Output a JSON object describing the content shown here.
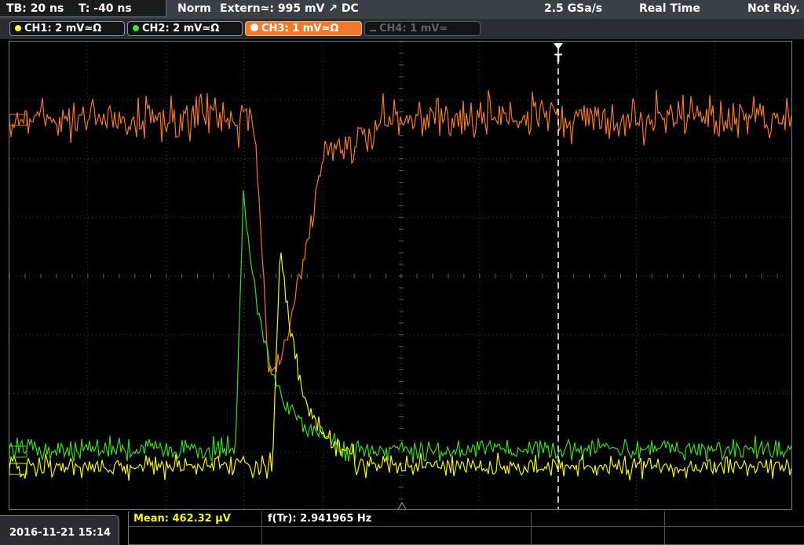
{
  "topbar": {
    "timebase": "TB: 20 ns",
    "trigger_time": "T: -40 ns",
    "mode": "Norm",
    "trigger": "Extern≃: 995 mV ↗ DC",
    "sample_rate": "2.5 GSa/s",
    "acquisition": "Real Time",
    "status": "Not Rdy."
  },
  "channels": [
    {
      "label": "CH1: 2 mV≃Ω",
      "color": "#ffff33",
      "state": "on"
    },
    {
      "label": "CH2: 2 mV≃Ω",
      "color": "#44dd33",
      "state": "on"
    },
    {
      "label": "CH3: 1 mV≃Ω",
      "color": "#f07a2c",
      "state": "active"
    },
    {
      "label": "CH4: 1 mV≃",
      "color": "#5e6368",
      "state": "off"
    }
  ],
  "trigger_marker": "T",
  "measurements": {
    "mean": "Mean: 462.32 µV",
    "freq": "f(Tr): 2.941965 Hz"
  },
  "datetime": "2016-11-21 15:14",
  "colors": {
    "ch1": "#f3f320",
    "ch2": "#3fd81e",
    "ch3": "#f07a2c",
    "grid": "#3d3d3d"
  }
}
